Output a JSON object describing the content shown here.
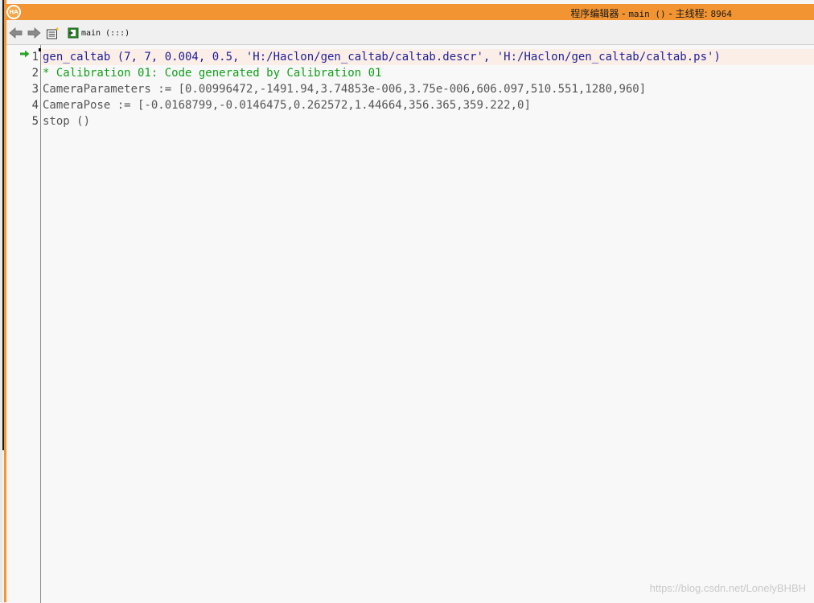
{
  "window": {
    "title_prefix": "程序编辑器 - ",
    "title_proc": "main ()",
    "title_mid": " - 主线程: ",
    "title_thread": "8964",
    "logo_text": "HA"
  },
  "toolbar": {
    "scope_label": "main (:::)"
  },
  "editor": {
    "current_line": 1,
    "lines": [
      {
        "number": "1",
        "text": "gen_caltab (7, 7, 0.004, 0.5, 'H:/Haclon/gen_caltab/caltab.descr', 'H:/Haclon/gen_caltab/caltab.ps')",
        "kind": "operator"
      },
      {
        "number": "2",
        "text": "* Calibration 01: Code generated by Calibration 01",
        "kind": "comment"
      },
      {
        "number": "3",
        "text": "CameraParameters := [0.00996472,-1491.94,3.74853e-006,3.75e-006,606.097,510.551,1280,960]",
        "kind": "assignment"
      },
      {
        "number": "4",
        "text": "CameraPose := [-0.0168799,-0.0146475,0.262572,1.44664,356.365,359.222,0]",
        "kind": "assignment"
      },
      {
        "number": "5",
        "text": "stop ()",
        "kind": "assignment"
      }
    ]
  },
  "watermark": "https://blog.csdn.net/LonelyBHBH",
  "colors": {
    "accent": "#f29431",
    "operator": "#1d1d99",
    "comment": "#11a01a",
    "assignment": "#555555",
    "current_line_bg": "#fbeee6"
  }
}
